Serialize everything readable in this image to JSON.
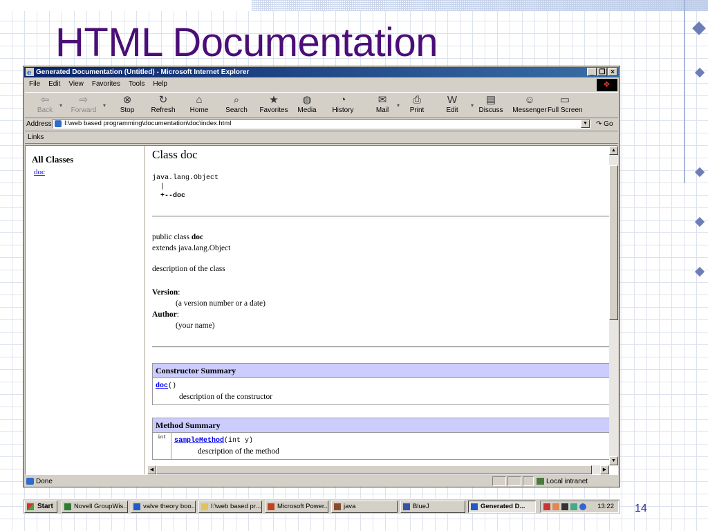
{
  "slide": {
    "title": "HTML Documentation",
    "number": "14"
  },
  "browser": {
    "window_title": "Generated Documentation (Untitled) - Microsoft Internet Explorer",
    "menu": [
      "File",
      "Edit",
      "View",
      "Favorites",
      "Tools",
      "Help"
    ],
    "toolbar": [
      {
        "label": "Back",
        "icon": "back-arrow-icon",
        "glyph": "⇦",
        "enabled": false
      },
      {
        "label": "Forward",
        "icon": "forward-arrow-icon",
        "glyph": "⇨",
        "enabled": false
      },
      {
        "label": "Stop",
        "icon": "stop-icon",
        "glyph": "⊗",
        "enabled": true
      },
      {
        "label": "Refresh",
        "icon": "refresh-icon",
        "glyph": "↻",
        "enabled": true
      },
      {
        "label": "Home",
        "icon": "home-icon",
        "glyph": "⌂",
        "enabled": true
      },
      {
        "label": "Search",
        "icon": "search-icon",
        "glyph": "⌕",
        "enabled": true
      },
      {
        "label": "Favorites",
        "icon": "favorites-icon",
        "glyph": "★",
        "enabled": true
      },
      {
        "label": "Media",
        "icon": "media-icon",
        "glyph": "◍",
        "enabled": true
      },
      {
        "label": "History",
        "icon": "history-icon",
        "glyph": "◔",
        "enabled": true
      },
      {
        "label": "Mail",
        "icon": "mail-icon",
        "glyph": "✉",
        "enabled": true
      },
      {
        "label": "Print",
        "icon": "print-icon",
        "glyph": "⎙",
        "enabled": true
      },
      {
        "label": "Edit",
        "icon": "edit-icon",
        "glyph": "W",
        "enabled": true
      },
      {
        "label": "Discuss",
        "icon": "discuss-icon",
        "glyph": "▤",
        "enabled": true
      },
      {
        "label": "Messenger",
        "icon": "messenger-icon",
        "glyph": "☺",
        "enabled": true
      },
      {
        "label": "Full Screen",
        "icon": "full-screen-icon",
        "glyph": "▭",
        "enabled": true
      }
    ],
    "address_label": "Address",
    "address": "I:\\web based programming\\documentation\\doc\\index.html",
    "go_label": "Go",
    "links_label": "Links",
    "status_text": "Done",
    "zone": "Local intranet"
  },
  "left_frame": {
    "heading": "All Classes",
    "classes": [
      "doc"
    ]
  },
  "doc_page": {
    "class_title": "Class doc",
    "hierarchy": [
      "java.lang.Object",
      "  |",
      "  +--doc"
    ],
    "decl_prefix": "public class ",
    "decl_name": "doc",
    "extends": "extends java.lang.Object",
    "description": "description of the class",
    "version_label": "Version",
    "version_value": "(a version number or a date)",
    "author_label": "Author",
    "author_value": "(your name)",
    "constructor_summary": {
      "title": "Constructor Summary",
      "name": "doc",
      "params": "()",
      "description": "description of the constructor"
    },
    "method_summary": {
      "title": "Method Summary",
      "modifier": "int",
      "name": "sampleMethod",
      "params": "(int y)",
      "description": "description of the method"
    }
  },
  "taskbar": {
    "start": "Start",
    "buttons": [
      {
        "label": "Novell GroupWis...",
        "active": false
      },
      {
        "label": "valve theory boo...",
        "active": false
      },
      {
        "label": "I:\\web based pr...",
        "active": false
      },
      {
        "label": "Microsoft Power...",
        "active": false
      },
      {
        "label": "java",
        "active": false
      },
      {
        "label": "BlueJ",
        "active": false
      },
      {
        "label": "Generated D...",
        "active": true
      }
    ],
    "clock": "13:22"
  },
  "colors": {
    "title_purple": "#4b0e78",
    "titlebar_blue": "#0a246a",
    "summary_header": "#ccccff",
    "link_blue": "#0000ee"
  }
}
